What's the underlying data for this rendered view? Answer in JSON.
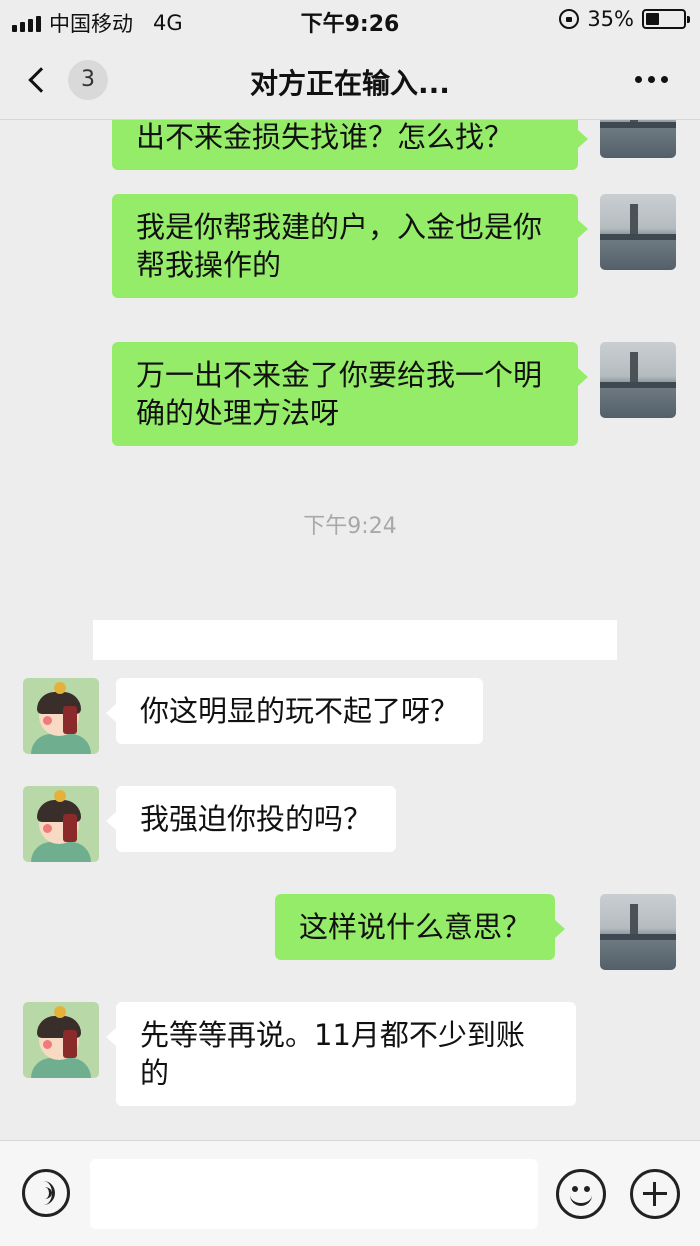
{
  "status_bar": {
    "carrier": "中国移动",
    "network": "4G",
    "time": "下午9:26",
    "battery_percent": "35%",
    "battery_level": 0.35
  },
  "nav": {
    "unread_count": "3",
    "title": "对方正在输入..."
  },
  "messages": [
    {
      "side": "right",
      "text": "出不来金损失找谁？怎么找？"
    },
    {
      "side": "right",
      "text": "我是你帮我建的户，入金也是你帮我操作的"
    },
    {
      "side": "right",
      "text": "万一出不来金了你要给我一个明确的处理方法呀"
    },
    {
      "side": "left",
      "text": "你这明显的玩不起了呀？"
    },
    {
      "side": "left",
      "text": "我强迫你投的吗？"
    },
    {
      "side": "right",
      "text": "这样说什么意思？"
    },
    {
      "side": "left",
      "text": "先等等再说。11月都不少到账的"
    }
  ],
  "timestamp": "下午9:24",
  "input_bar": {
    "input_value": ""
  },
  "icons": {
    "back": "chevron-left-icon",
    "more": "more-dots-icon",
    "voice": "voice-icon",
    "emoji": "emoji-icon",
    "add": "plus-icon"
  },
  "colors": {
    "sent_bubble": "#95ec69",
    "received_bubble": "#ffffff",
    "background": "#ededed"
  }
}
